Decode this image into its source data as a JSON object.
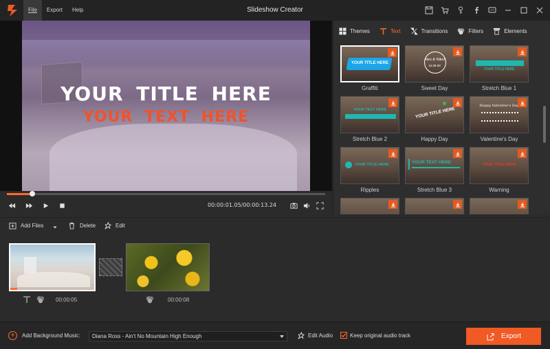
{
  "app": {
    "title": "Slideshow Creator"
  },
  "menu": [
    {
      "label": "File",
      "active": true
    },
    {
      "label": "Export",
      "active": false
    },
    {
      "label": "Help",
      "active": false
    }
  ],
  "window_icons": [
    "save-icon",
    "cart-icon",
    "key-icon",
    "facebook-icon",
    "feedback-icon",
    "minimize-icon",
    "maximize-icon",
    "close-icon"
  ],
  "preview": {
    "title_text": "YOUR  TITLE  HERE",
    "subtitle_text": "YOUR  TEXT  HERE",
    "subtitle_color": "#f0532a",
    "progress_fraction": 0.08,
    "time": "00:00:01.05/00:00:13.24"
  },
  "tabs": [
    {
      "label": "Themes",
      "icon": "themes-icon",
      "active": false
    },
    {
      "label": "Text",
      "icon": "text-icon",
      "active": true
    },
    {
      "label": "Transitions",
      "icon": "transitions-icon",
      "active": false
    },
    {
      "label": "Filters",
      "icon": "filters-icon",
      "active": false
    },
    {
      "label": "Elements",
      "icon": "elements-icon",
      "active": false
    }
  ],
  "text_templates": [
    {
      "label": "Graffiti",
      "selected": true
    },
    {
      "label": "Sweet Day",
      "selected": false
    },
    {
      "label": "Stretch Blue 1",
      "selected": false
    },
    {
      "label": "Stretch Blue 2",
      "selected": false
    },
    {
      "label": "Happy Day",
      "selected": false
    },
    {
      "label": "Valentine's Day",
      "selected": false
    },
    {
      "label": "Ripples",
      "selected": false
    },
    {
      "label": "Stretch Blue 3",
      "selected": false
    },
    {
      "label": "Warning",
      "selected": false
    }
  ],
  "thumb_text": {
    "graffiti": "YOUR TITLE HERE",
    "sweet_day_names": "Alex & Nikol",
    "sweet_day_date": "16.08.08",
    "stretch_blue_2": "YOUR TEXT HERE",
    "happy_day": "YOUR TITLE HERE",
    "valentines": "Happy Valentine's Day",
    "ripples": "YOUR TITLE HERE",
    "stretch_blue_3": "YOUR TEXT HERE",
    "warning": "YOUR TITLE HERE",
    "stretch_blue_1": "YOUR TITLE HERE"
  },
  "toolbar": {
    "add_files": "Add Files",
    "delete": "Delete",
    "edit": "Edit"
  },
  "clips": [
    {
      "duration": "00:00:05",
      "selected": true
    },
    {
      "duration": "00:00:08",
      "selected": false
    }
  ],
  "bottom": {
    "bg_music_label": "Add Background Music:",
    "music_selected": "Diana Ross - Ain't No Mountain High Enough",
    "edit_audio": "Edit Audio",
    "keep_audio": "Keep original audio track",
    "keep_audio_checked": true,
    "export": "Export"
  },
  "colors": {
    "accent": "#f05a24",
    "text_accent": "#ff6b2c",
    "teal": "#1fb7b2"
  }
}
